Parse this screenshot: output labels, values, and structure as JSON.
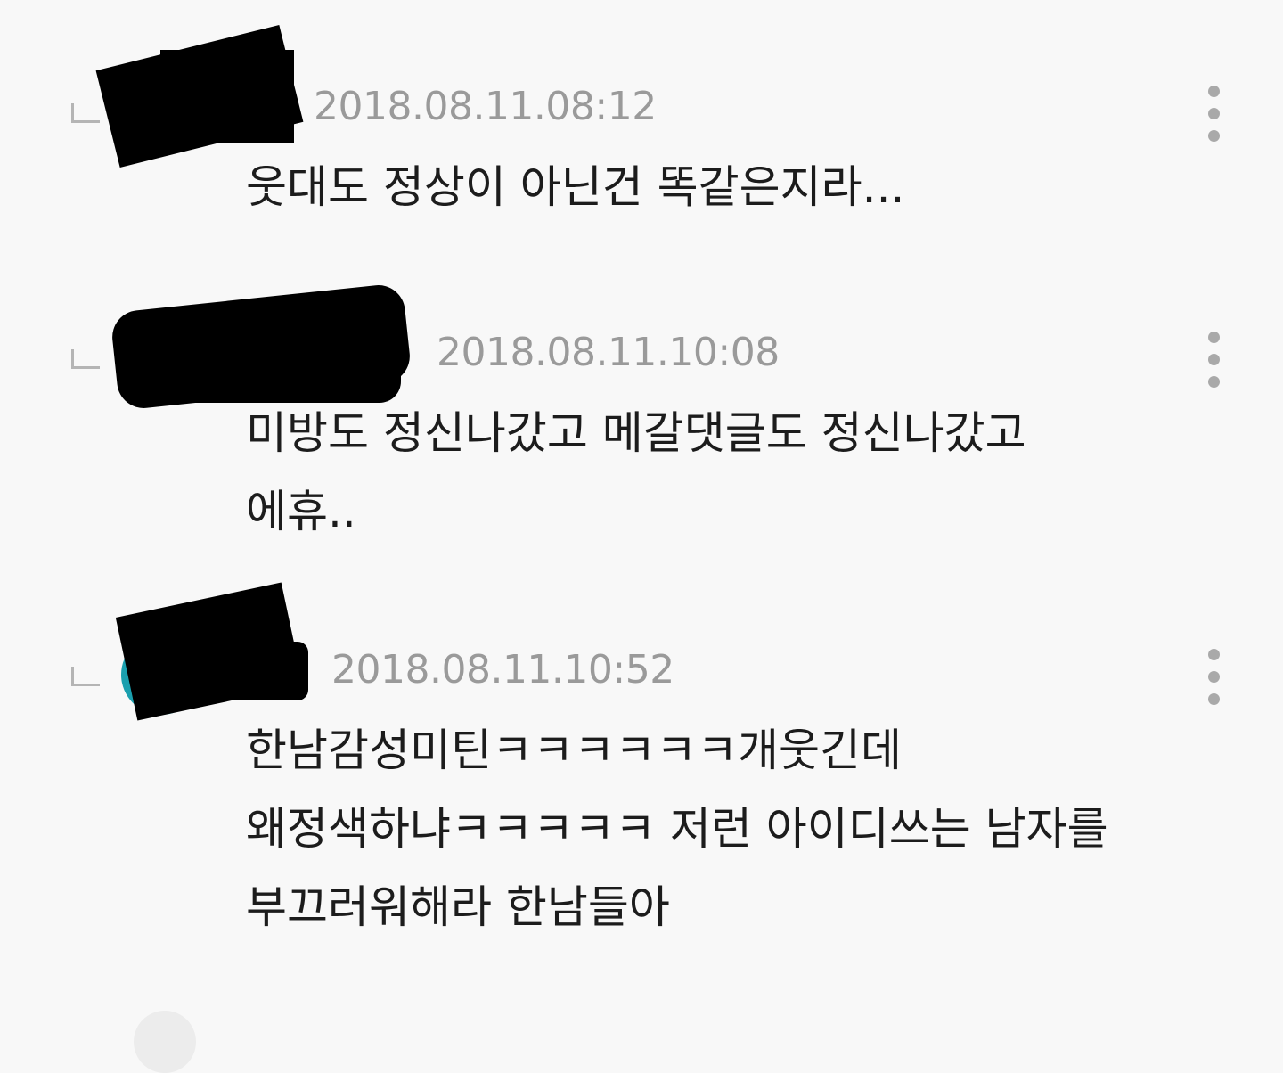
{
  "comments": [
    {
      "timestamp": "2018.08.11.08:12",
      "lines": [
        "웃대도 정상이 아닌건 똑같은지라..."
      ]
    },
    {
      "timestamp": "2018.08.11.10:08",
      "lines": [
        "미방도 정신나갔고 메갈댓글도 정신나갔고",
        "에휴.."
      ]
    },
    {
      "timestamp": "2018.08.11.10:52",
      "lines": [
        "한남감성미틴ㅋㅋㅋㅋㅋㅋ개웃긴데",
        "왜정색하냐ㅋㅋㅋㅋㅋ 저런 아이디쓰는 남자를",
        "부끄러워해라 한남들아"
      ]
    }
  ],
  "icons": {
    "reply_arrow": "reply-arrow-icon",
    "more": "more-vertical-icon"
  },
  "colors": {
    "background": "#f8f8f8",
    "timestamp": "#9a9a9a",
    "text": "#1c1c1c",
    "avatar_teal": "#1a9fae"
  }
}
